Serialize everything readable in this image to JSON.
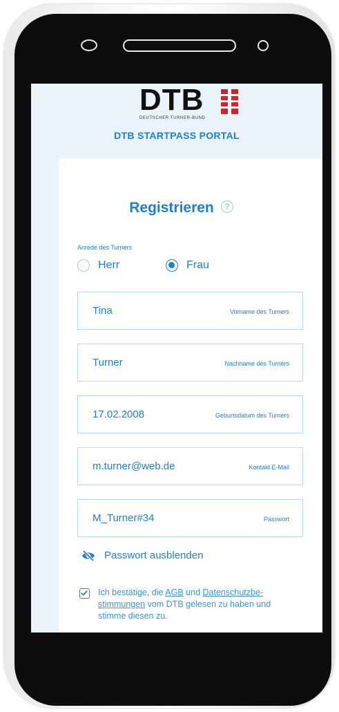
{
  "header": {
    "logo_text": "DTB",
    "logo_subtitle": "DEUTSCHER TURNER-BUND",
    "portal_title": "DTB STARTPASS PORTAL"
  },
  "form": {
    "title": "Registrieren",
    "help_icon": "?",
    "salutation_label": "Anrede des Turners",
    "salutation_options": [
      "Herr",
      "Frau"
    ],
    "salutation_selected": "Frau",
    "fields": [
      {
        "value": "Tina",
        "label": "Vorname des Turners"
      },
      {
        "value": "Turner",
        "label": "Nachname des Turners"
      },
      {
        "value": "17.02.2008",
        "label": "Geburtsdatum des Turners"
      },
      {
        "value": "m.turner@web.de",
        "label": "Kontakt E-Mail"
      },
      {
        "value": "M_Turner#34",
        "label": "Passwort"
      }
    ],
    "toggle_password_label": "Passwort ausblenden",
    "consent": {
      "checked": true,
      "part1": "Ich bestätige, die ",
      "agb": "AGB",
      "part2": " und ",
      "privacy_1": "Datenschutzbe-",
      "privacy_2": "stimmungen",
      "part3": " vom DTB gelesen zu haben und stimme diesen zu."
    }
  },
  "colors": {
    "accent": "#1c7fd1",
    "light_accent": "#9fccef",
    "header_bg": "#eaf3fb",
    "logo_red": "#d4242a"
  },
  "icons": [
    "help-icon",
    "eye-slash-icon",
    "check-icon",
    "dtb-logo-icon"
  ]
}
